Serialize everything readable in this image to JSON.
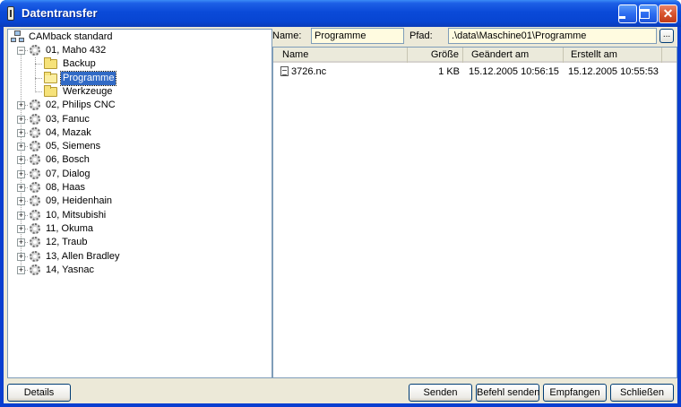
{
  "window": {
    "title": "Datentransfer"
  },
  "tree": {
    "root": "CAMback standard",
    "machines": [
      {
        "label": "01, Maho 432",
        "expanded": true,
        "children": [
          {
            "label": "Backup",
            "selected": false
          },
          {
            "label": "Programme",
            "selected": true
          },
          {
            "label": "Werkzeuge",
            "selected": false
          }
        ]
      },
      {
        "label": "02, Philips CNC"
      },
      {
        "label": "03, Fanuc"
      },
      {
        "label": "04, Mazak"
      },
      {
        "label": "05, Siemens"
      },
      {
        "label": "06, Bosch"
      },
      {
        "label": "07, Dialog"
      },
      {
        "label": "08, Haas"
      },
      {
        "label": "09, Heidenhain"
      },
      {
        "label": "10, Mitsubishi"
      },
      {
        "label": "11, Okuma"
      },
      {
        "label": "12, Traub"
      },
      {
        "label": "13, Allen Bradley"
      },
      {
        "label": "14, Yasnac"
      }
    ]
  },
  "path_bar": {
    "name_label": "Name:",
    "name_value": "Programme",
    "path_label": "Pfad:",
    "path_value": ".\\data\\Maschine01\\Programme",
    "browse_label": "..."
  },
  "file_list": {
    "columns": [
      "Name",
      "Größe",
      "Geändert am",
      "Erstellt am"
    ],
    "rows": [
      {
        "name": "3726.nc",
        "size": "1 KB",
        "modified": "15.12.2005 10:56:15",
        "created": "15.12.2005 10:55:53"
      }
    ]
  },
  "buttons": {
    "details": "Details",
    "send": "Senden",
    "send_command": "Befehl senden",
    "receive": "Empfangen",
    "close": "Schließen"
  }
}
